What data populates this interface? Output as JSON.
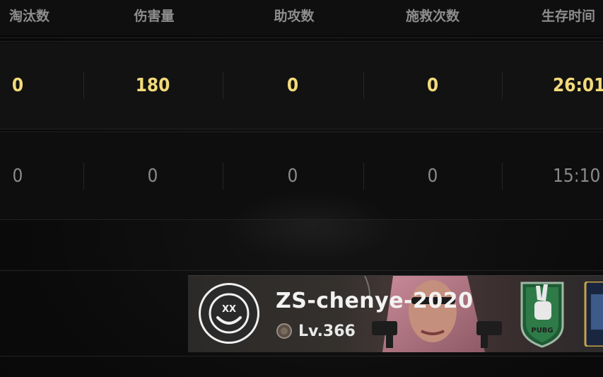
{
  "columns": [
    {
      "key": "eliminations",
      "label": "淘汰数"
    },
    {
      "key": "damage",
      "label": "伤害量"
    },
    {
      "key": "assists",
      "label": "助攻数"
    },
    {
      "key": "revives",
      "label": "施救次数"
    },
    {
      "key": "survival",
      "label": "生存时间"
    }
  ],
  "rows": [
    {
      "highlight": true,
      "values": [
        "0",
        "180",
        "0",
        "0",
        "26:01"
      ]
    },
    {
      "highlight": false,
      "values": [
        "0",
        "0",
        "0",
        "0",
        "15:10"
      ]
    }
  ],
  "player": {
    "name": "ZS-chenye-2020",
    "level": "Lv.366",
    "avatar_icon": "dizzy-smiley-icon",
    "badge_icon": "pubg-peace-hand-badge-icon",
    "badge_text": "PUBG"
  },
  "colors": {
    "highlight_value": "#f2da7a",
    "dim_value": "#8a8a8a",
    "header_text": "#8d8d8d"
  }
}
